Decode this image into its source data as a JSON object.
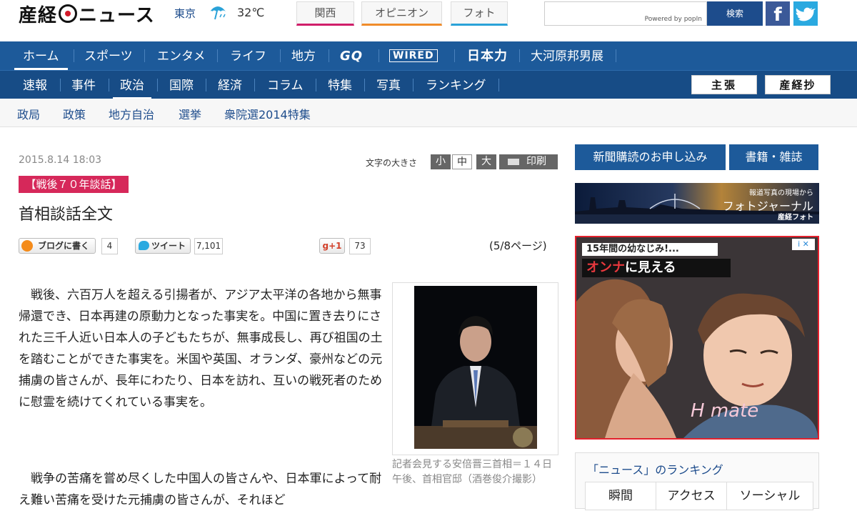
{
  "header": {
    "logo": "産経ニュース",
    "weather": {
      "city": "東京",
      "temperature": "32℃",
      "icon": "umbrella-icon"
    },
    "tabs": [
      "関西",
      "オピニオン",
      "フォト"
    ],
    "search": {
      "placeholder": "",
      "powered_by": "Powered by popIn",
      "button": "検索"
    },
    "social": [
      "facebook-icon",
      "twitter-icon"
    ]
  },
  "nav_primary": [
    "ホーム",
    "スポーツ",
    "エンタメ",
    "ライフ",
    "地方",
    "GQ",
    "WIRED",
    "日本力",
    "大河原邦男展"
  ],
  "nav_secondary": [
    "速報",
    "事件",
    "政治",
    "国際",
    "経済",
    "コラム",
    "特集",
    "写真",
    "ランキング"
  ],
  "nav_secondary_buttons": [
    "主張",
    "産経抄"
  ],
  "subnav": [
    "政局",
    "政策",
    "地方自治",
    "選挙",
    "衆院選2014特集"
  ],
  "article": {
    "date": "2015.8.14 18:03",
    "font_size_label": "文字の大きさ",
    "font_sizes": [
      "小",
      "中",
      "大"
    ],
    "print_label": "印刷",
    "tag": "【戦後７０年談話】",
    "headline": "首相談話全文",
    "share": {
      "hatena_label": "ブログに書く",
      "hatena_count": "4",
      "tweet_label": "ツイート",
      "tweet_count": "7,101",
      "gplus_label": "g+1",
      "gplus_count": "73"
    },
    "page_indicator": "(5/8ページ)",
    "paragraphs": [
      "戦後、六百万人を超える引揚者が、アジア太平洋の各地から無事帰還でき、日本再建の原動力となった事実を。中国に置き去りにされた三千人近い日本人の子どもたちが、無事成長し、再び祖国の土を踏むことができた事実を。米国や英国、オランダ、豪州などの元捕虜の皆さんが、長年にわたり、日本を訪れ、互いの戦死者のために慰霊を続けてくれている事実を。",
      "戦争の苦痛を嘗め尽くした中国人の皆さんや、日本軍によって耐え難い苦痛を受けた元捕虜の皆さんが、それほど"
    ],
    "photo_caption": "記者会見する安倍晋三首相＝１４日午後、首相官邸（酒巻俊介撮影）"
  },
  "sidebar": {
    "subscribe": "新聞購読のお申し込み",
    "books": "書籍・雑誌",
    "photojournal": {
      "sub": "報道写真の現場から",
      "title": "フォトジャーナル",
      "brand": "産経フォト"
    },
    "ad": {
      "line1": "15年間の幼なじみ!...",
      "line2_highlight": "オンナ",
      "line2_rest": "に見える",
      "choices": "i ✕",
      "mark": "H mate"
    },
    "ranking": {
      "title": "「ニュース」のランキング",
      "tabs": [
        "瞬間",
        "アクセス",
        "ソーシャル"
      ]
    }
  }
}
